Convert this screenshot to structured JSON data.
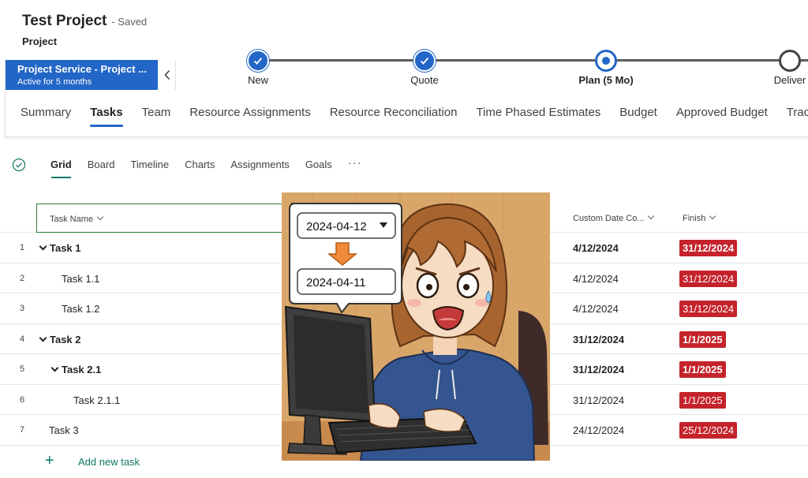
{
  "header": {
    "title": "Test Project",
    "save_status": "- Saved",
    "record_type": "Project"
  },
  "bpf": {
    "process_name": "Project Service - Project ...",
    "process_duration": "Active for 5 months",
    "stages": [
      {
        "label": "New",
        "state": "done"
      },
      {
        "label": "Quote",
        "state": "done"
      },
      {
        "label": "Plan  (5 Mo)",
        "state": "active"
      },
      {
        "label": "Deliver",
        "state": "todo"
      }
    ]
  },
  "main_tabs": [
    "Summary",
    "Tasks",
    "Team",
    "Resource Assignments",
    "Resource Reconciliation",
    "Time Phased Estimates",
    "Budget",
    "Approved Budget",
    "Tracking"
  ],
  "view_tabs": [
    "Grid",
    "Board",
    "Timeline",
    "Charts",
    "Assignments",
    "Goals"
  ],
  "more_label": "···",
  "grid": {
    "columns": {
      "task_name": "Task Name",
      "custom_date": "Custom Date Co...",
      "finish": "Finish"
    },
    "rows": [
      {
        "num": "1",
        "name": "Task 1",
        "custom_date": "4/12/2024",
        "finish": "31/12/2024"
      },
      {
        "num": "2",
        "name": "Task 1.1",
        "custom_date": "4/12/2024",
        "finish": "31/12/2024"
      },
      {
        "num": "3",
        "name": "Task 1.2",
        "custom_date": "4/12/2024",
        "finish": "31/12/2024"
      },
      {
        "num": "4",
        "name": "Task 2",
        "custom_date": "31/12/2024",
        "finish": "1/1/2025"
      },
      {
        "num": "5",
        "name": "Task 2.1",
        "custom_date": "31/12/2024",
        "finish": "1/1/2025"
      },
      {
        "num": "6",
        "name": "Task 2.1.1",
        "custom_date": "31/12/2024",
        "finish": "1/1/2025"
      },
      {
        "num": "7",
        "name": "Task 3",
        "custom_date": "24/12/2024",
        "finish": "25/12/2024"
      }
    ],
    "add_task_label": "Add new task"
  },
  "illustration": {
    "date_before": "2024-04-12",
    "date_after": "2024-04-11"
  },
  "colors": {
    "brand_blue": "#2266c7",
    "late_red": "#c5232b",
    "accent_green": "#117865"
  }
}
